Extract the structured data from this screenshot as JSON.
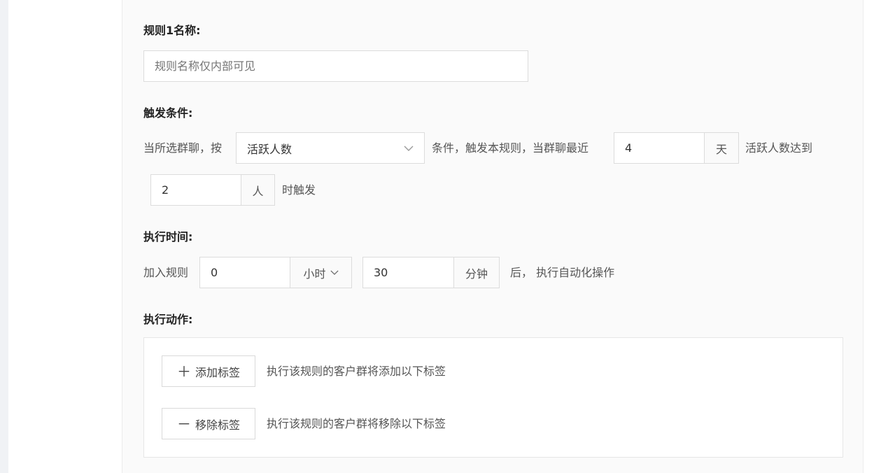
{
  "rule_name": {
    "title": "规则1名称:",
    "placeholder": "规则名称仅内部可见"
  },
  "trigger": {
    "title": "触发条件:",
    "prefix": "当所选群聊，按",
    "select_value": "活跃人数",
    "middle": "条件，触发本规则，当群聊最近",
    "days_value": "4",
    "days_unit": "天",
    "after_days": "活跃人数达到",
    "people_value": "2",
    "people_unit": "人",
    "suffix": "时触发"
  },
  "exec_time": {
    "title": "执行时间:",
    "prefix": "加入规则",
    "hours_value": "0",
    "hours_unit": "小时",
    "minutes_value": "30",
    "minutes_unit": "分钟",
    "suffix": "后， 执行自动化操作"
  },
  "actions": {
    "title": "执行动作:",
    "add_tag_label": "添加标签",
    "add_tag_desc": "执行该规则的客户群将添加以下标签",
    "remove_tag_label": "移除标签",
    "remove_tag_desc": "执行该规则的客户群将移除以下标签"
  }
}
